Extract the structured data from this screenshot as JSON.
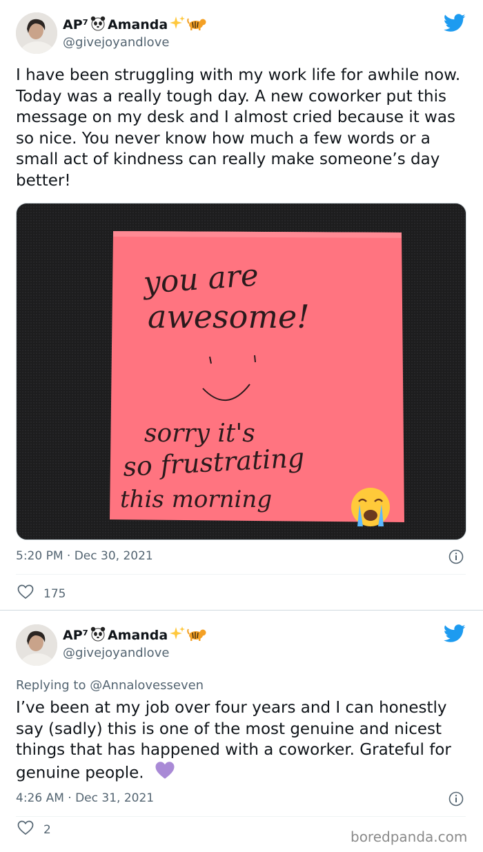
{
  "tweets": [
    {
      "author": {
        "name_prefix": "AP⁷",
        "name": "Amanda",
        "handle": "@givejoyandlove"
      },
      "text": "I have been struggling with my work life for awhile now. Today was a really tough day. A new coworker put this message on my desk and I almost cried because it was so nice. You never know how much a few words or a small act of kindness can really make someone’s day better!",
      "photo_note": {
        "lines": [
          "you are",
          "awesome!",
          "sorry it's",
          "so frustrating",
          "this morning"
        ],
        "note_color": "#ff7480"
      },
      "time": "5:20 PM · Dec 30, 2021",
      "likes": "175"
    },
    {
      "author": {
        "name_prefix": "AP⁷",
        "name": "Amanda",
        "handle": "@givejoyandlove"
      },
      "replying_to": {
        "label": "Replying to",
        "mention": "@Annalovesseven"
      },
      "text": "I’ve been at my job over four years and I can honestly say (sadly) this is one of the most genuine and nicest things that has happened with a coworker. Grateful for genuine people.",
      "time": "4:26 AM · Dec 31, 2021",
      "likes": "2"
    }
  ],
  "watermark": "boredpanda.com",
  "colors": {
    "twitter_blue": "#1d9bf0",
    "secondary_text": "#536471",
    "heart_purple": "#a98ad6"
  }
}
